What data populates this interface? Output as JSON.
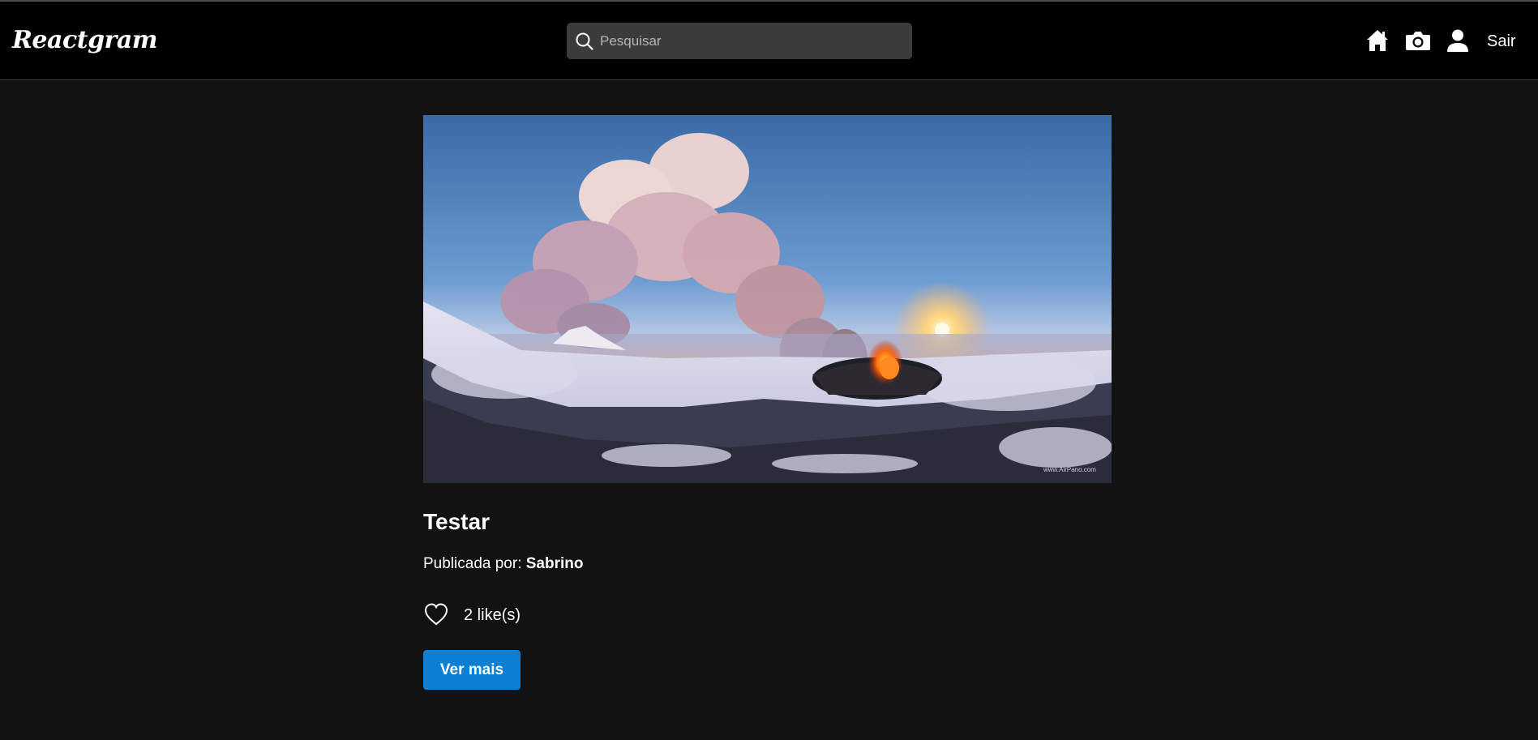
{
  "header": {
    "logo": "Reactgram",
    "search_placeholder": "Pesquisar",
    "search_value": "",
    "nav": {
      "home_icon": "home-icon",
      "camera_icon": "camera-icon",
      "profile_icon": "user-icon",
      "logout_label": "Sair"
    }
  },
  "post": {
    "image_alt": "",
    "title": "Testar",
    "author_prefix": "Publicada por:",
    "author_name": "Sabrino",
    "likes_text": "2 like(s)",
    "like_icon": "heart-outline-icon",
    "details_button": "Ver mais"
  },
  "colors": {
    "background": "#121212",
    "navbar": "#000000",
    "search_bg": "#3b3b3b",
    "accent_button": "#0a7fd3",
    "text": "#ffffff"
  }
}
